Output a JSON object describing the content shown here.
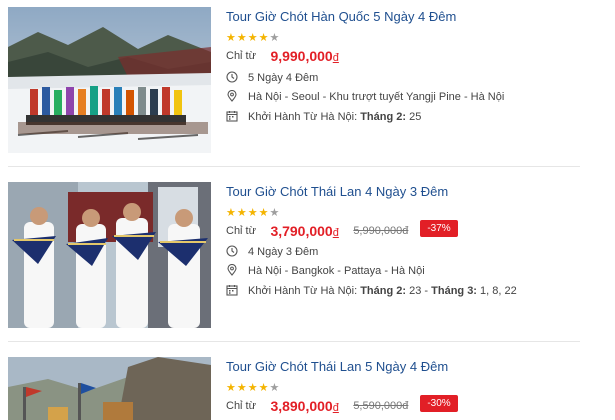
{
  "tours": [
    {
      "title": "Tour Giờ Chót Hàn Quốc 5 Ngày 4 Đêm",
      "rating": 4,
      "max_rating": 5,
      "from_label": "Chỉ từ",
      "price": "9,990,000",
      "currency": "đ",
      "old_price": "",
      "discount": "",
      "duration": "5 Ngày 4 Đêm",
      "route": "Hà Nội - Seoul - Khu trượt tuyết Yangji Pine - Hà Nội",
      "depart_label": "Khởi Hành Từ Hà Nội:",
      "depart_dates": [
        {
          "month": "Tháng 2:",
          "days": "25"
        }
      ]
    },
    {
      "title": "Tour Giờ Chót Thái Lan 4 Ngày 3 Đêm",
      "rating": 4,
      "max_rating": 5,
      "from_label": "Chỉ từ",
      "price": "3,790,000",
      "currency": "đ",
      "old_price": "5,990,000đ",
      "discount": "-37%",
      "duration": "4 Ngày 3 Đêm",
      "route": "Hà Nội - Bangkok - Pattaya - Hà Nội",
      "depart_label": "Khởi Hành Từ Hà Nội:",
      "depart_dates": [
        {
          "month": "Tháng 2:",
          "days": "23"
        },
        {
          "month": "Tháng 3:",
          "days": "1, 8, 22"
        }
      ]
    },
    {
      "title": "Tour Giờ Chót Thái Lan 5 Ngày 4 Đêm",
      "rating": 4,
      "max_rating": 5,
      "from_label": "Chỉ từ",
      "price": "3,890,000",
      "currency": "đ",
      "old_price": "5,590,000đ",
      "discount": "-30%"
    }
  ],
  "colors": {
    "title": "#1f4f8f",
    "price": "#e21f26",
    "star": "#f4b400",
    "badge": "#e21f26"
  }
}
